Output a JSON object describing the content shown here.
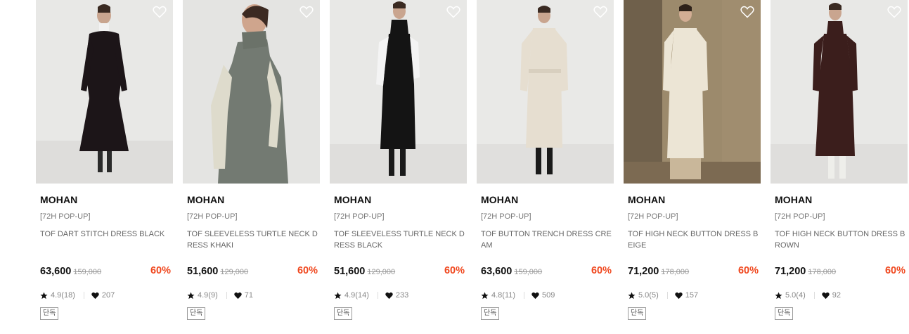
{
  "products": [
    {
      "brand": "MOHAN",
      "tag": "[72H POP-UP]",
      "name": "TOF DART STITCH DRESS BLACK",
      "price": "63,600",
      "original_price": "159,000",
      "discount": "60%",
      "rating": "4.9(18)",
      "likes": "207",
      "badge": "단독",
      "liked": false
    },
    {
      "brand": "MOHAN",
      "tag": "[72H POP-UP]",
      "name": "TOF SLEEVELESS TURTLE NECK DRESS KHAKI",
      "price": "51,600",
      "original_price": "129,000",
      "discount": "60%",
      "rating": "4.9(9)",
      "likes": "71",
      "badge": "단독",
      "liked": false
    },
    {
      "brand": "MOHAN",
      "tag": "[72H POP-UP]",
      "name": "TOF SLEEVELESS TURTLE NECK DRESS BLACK",
      "price": "51,600",
      "original_price": "129,000",
      "discount": "60%",
      "rating": "4.9(14)",
      "likes": "233",
      "badge": "단독",
      "liked": false
    },
    {
      "brand": "MOHAN",
      "tag": "[72H POP-UP]",
      "name": "TOF BUTTON TRENCH DRESS CREAM",
      "price": "63,600",
      "original_price": "159,000",
      "discount": "60%",
      "rating": "4.8(11)",
      "likes": "509",
      "badge": "단독",
      "liked": false
    },
    {
      "brand": "MOHAN",
      "tag": "[72H POP-UP]",
      "name": "TOF HIGH NECK BUTTON DRESS BEIGE",
      "price": "71,200",
      "original_price": "178,000",
      "discount": "60%",
      "rating": "5.0(5)",
      "likes": "157",
      "badge": "단독",
      "liked": false
    },
    {
      "brand": "MOHAN",
      "tag": "[72H POP-UP]",
      "name": "TOF HIGH NECK BUTTON DRESS BROWN",
      "price": "71,200",
      "original_price": "178,000",
      "discount": "60%",
      "rating": "5.0(4)",
      "likes": "92",
      "badge": "단독",
      "liked": false
    }
  ],
  "colors": {
    "discount": "#f0481f",
    "price": "#111111",
    "muted": "#888888"
  },
  "icons": {
    "wishlist": "heart-outline-icon",
    "rating": "star-icon",
    "likes": "heart-filled-icon"
  }
}
